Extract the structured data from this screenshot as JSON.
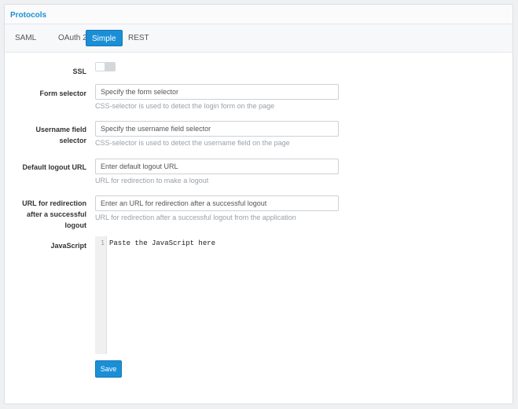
{
  "panel": {
    "title": "Protocols"
  },
  "tabs": [
    {
      "label": "SAML"
    },
    {
      "label": "OAuth 2.0"
    },
    {
      "label": "Simple",
      "active": true
    },
    {
      "label": "REST"
    }
  ],
  "form": {
    "ssl": {
      "label": "SSL",
      "enabled": false
    },
    "form_selector": {
      "label": "Form selector",
      "placeholder": "Specify the form selector",
      "help": "CSS-selector is used to detect the login form on the page"
    },
    "username_selector": {
      "label_line1": "Username field",
      "label_line2": "selector",
      "placeholder": "Specify the username field selector",
      "help": "CSS-selector is used to detect the username field on the page"
    },
    "logout_url": {
      "label": "Default logout URL",
      "placeholder": "Enter default logout URL",
      "help": "URL for redirection to make a logout"
    },
    "redirect_url": {
      "label_line1": "URL for redirection",
      "label_line2": "after a successful",
      "label_line3": "logout",
      "placeholder": "Enter an URL for redirection after a successful logout",
      "help": "URL for redirection after a successful logout from the application"
    },
    "javascript": {
      "label": "JavaScript",
      "line_number": "1",
      "placeholder": "Paste the JavaScript here"
    }
  },
  "actions": {
    "save_label": "Save"
  },
  "colors": {
    "accent": "#1b8fd6",
    "help_text": "#9aa1a8"
  }
}
